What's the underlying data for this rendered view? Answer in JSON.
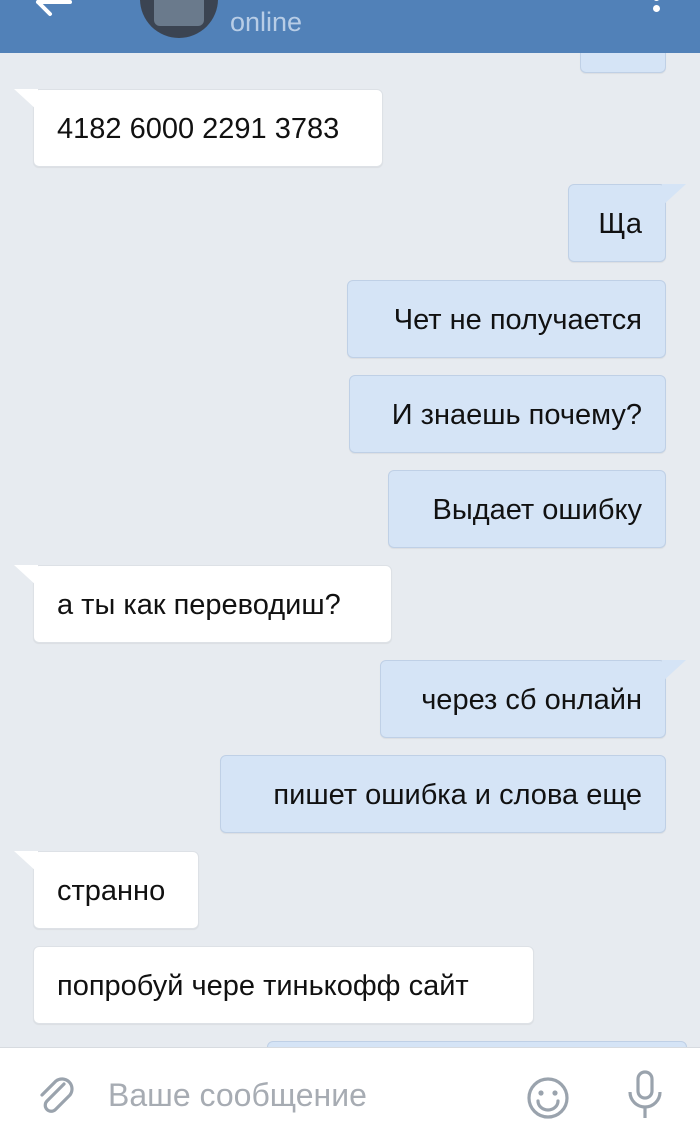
{
  "header": {
    "status": "online"
  },
  "messages": [
    {
      "direction": "in",
      "text": "4182 6000 2291 3783",
      "tail": true
    },
    {
      "direction": "out",
      "text": "Ща",
      "tail": true
    },
    {
      "direction": "out",
      "text": "Чет не получается",
      "tail": false
    },
    {
      "direction": "out",
      "text": "И знаешь почему?",
      "tail": false
    },
    {
      "direction": "out",
      "text": "Выдает ошибку",
      "tail": false
    },
    {
      "direction": "in",
      "text": "а ты как переводиш?",
      "tail": true
    },
    {
      "direction": "out",
      "text": "через сб онлайн",
      "tail": true
    },
    {
      "direction": "out",
      "text": "пишет ошибка и слова еще",
      "tail": false
    },
    {
      "direction": "in",
      "text": "странно",
      "tail": true
    },
    {
      "direction": "in",
      "text": "попробуй чере тинькофф сайт",
      "tail": false
    }
  ],
  "composer": {
    "placeholder": "Ваше сообщение"
  },
  "icons": {
    "back": "back-arrow-icon",
    "menu": "more-vertical-icon",
    "attach": "paperclip-icon",
    "emoji": "smile-icon",
    "voice": "microphone-icon"
  },
  "colors": {
    "header": "#5181b8",
    "background": "#e7ebf0",
    "incoming_bubble": "#ffffff",
    "outgoing_bubble": "#d5e4f6",
    "icon_gray": "#9aa3ad"
  }
}
